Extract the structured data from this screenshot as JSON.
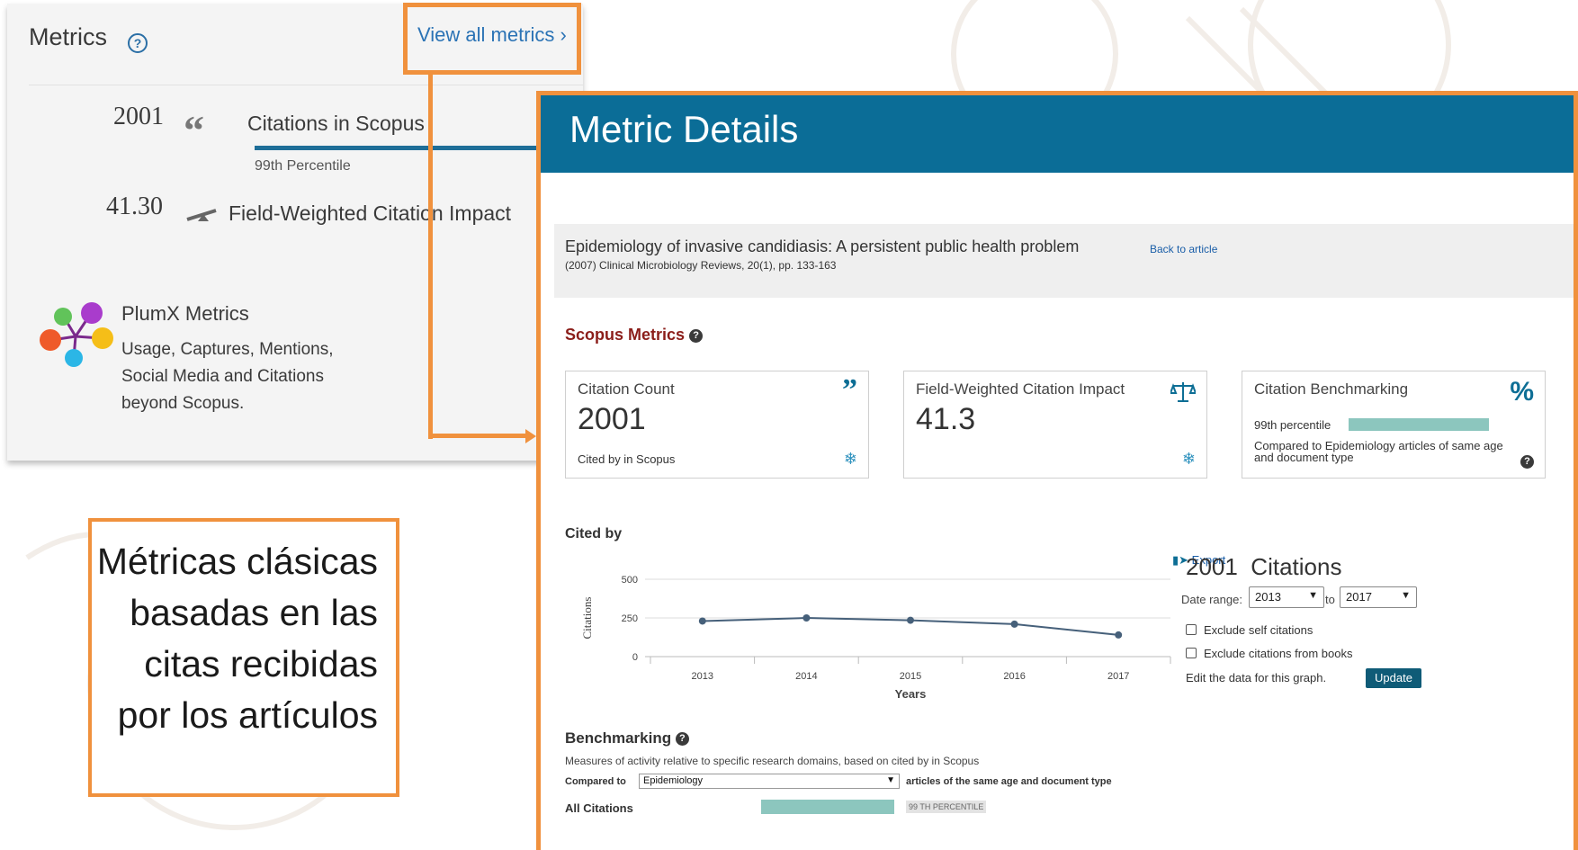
{
  "metrics_card": {
    "title": "Metrics",
    "view_all": "View all metrics",
    "view_all_chevron": "›",
    "citations_count": "2001",
    "citations_label": "Citations in Scopus",
    "citations_percentile": "99th Percentile",
    "fwci_value": "41.30",
    "fwci_label": "Field-Weighted Citation Impact",
    "plumx_title": "PlumX Metrics",
    "plumx_desc": "Usage, Captures, Mentions, Social Media and Citations beyond Scopus.",
    "icons": [
      "help-icon",
      "quote-icon",
      "scale-icon",
      "plumx-logo"
    ]
  },
  "callout": {
    "text": "Métricas clásicas basadas en las citas recibidas por los artículos"
  },
  "panel": {
    "title": "Metric Details",
    "article_title": "Epidemiology of invasive candidiasis: A persistent public health problem",
    "back_link": "Back to article",
    "article_source": "(2007) Clinical Microbiology Reviews, 20(1), pp. 133-163",
    "scopus_metrics": "Scopus Metrics",
    "boxes": [
      {
        "label": "Citation Count",
        "value": "2001",
        "foot": "Cited by in Scopus",
        "icon": "quote-icon"
      },
      {
        "label": "Field-Weighted Citation Impact",
        "value": "41.3",
        "icon": "scale-icon"
      },
      {
        "label": "Citation Benchmarking",
        "percentile": "99th percentile",
        "desc": "Compared to Epidemiology articles of same age and document type",
        "icon": "percent-icon"
      }
    ],
    "cited_by": "Cited by",
    "export": "Export",
    "citations_heading": "2001  Citations",
    "date_range_label": "Date range:",
    "date_from": "2013",
    "to_label": "to",
    "date_to": "2017",
    "exclude_self": "Exclude self citations",
    "exclude_books": "Exclude citations from books",
    "edit_label": "Edit the data for this graph.",
    "update": "Update",
    "benchmarking_title": "Benchmarking",
    "benchmarking_desc": "Measures of activity relative to specific research domains, based on cited by in Scopus",
    "compared_to": "Compared to",
    "compared_value": "Epidemiology",
    "compared_tail": "articles of the same age and document type",
    "all_citations": "All Citations",
    "all_citations_tag": "99 TH PERCENTILE",
    "colors": {
      "header": "#0b6d97",
      "accent": "#f0913d",
      "bench_bar": "#8cc6be"
    }
  },
  "chart_data": {
    "type": "line",
    "x": [
      2013,
      2014,
      2015,
      2016,
      2017
    ],
    "values": [
      230,
      250,
      235,
      210,
      140
    ],
    "ylabel": "Citations",
    "xlabel": "Years",
    "ylim": [
      0,
      500
    ],
    "yticks": [
      0,
      250,
      500
    ]
  }
}
